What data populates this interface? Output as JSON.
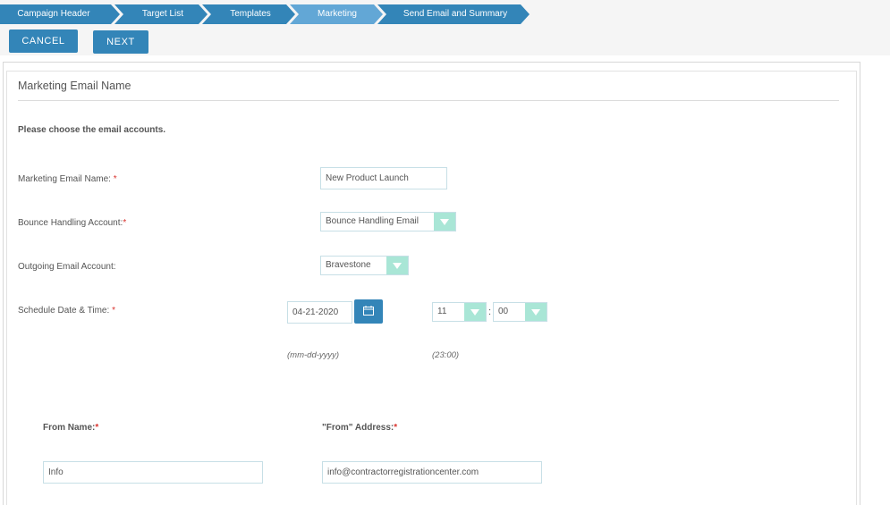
{
  "wizard": {
    "steps": [
      {
        "label": "Campaign Header",
        "active": false
      },
      {
        "label": "Target List",
        "active": false
      },
      {
        "label": "Templates",
        "active": false
      },
      {
        "label": "Marketing",
        "active": true
      },
      {
        "label": "Send Email and Summary",
        "active": false
      }
    ]
  },
  "actions": {
    "cancel_label": "CANCEL",
    "next_label": "NEXT"
  },
  "panel": {
    "title": "Marketing Email Name",
    "instruction": "Please choose the email accounts."
  },
  "form": {
    "marketing_email_name": {
      "label": "Marketing Email Name:",
      "required": "*",
      "value": "New Product Launch"
    },
    "bounce_account": {
      "label": "Bounce Handling Account:",
      "required": "*",
      "value": "Bounce Handling Email"
    },
    "outgoing_account": {
      "label": "Outgoing Email Account:",
      "value": "Bravestone"
    },
    "schedule": {
      "label": "Schedule Date & Time:",
      "required": "*",
      "date_value": "04-21-2020",
      "date_hint": "(mm-dd-yyyy)",
      "hour_value": "11",
      "separator": ":",
      "minute_value": "00",
      "time_hint": "(23:00)"
    },
    "from_name": {
      "label": "From Name:",
      "required": "*",
      "value": "Info"
    },
    "from_address": {
      "label": "\"From\" Address:",
      "required": "*",
      "value": "info@contractorregistrationcenter.com"
    }
  },
  "colors": {
    "accent": "#3385b8",
    "active_step": "#62a7d6",
    "select_arrow": "#a9e6d6",
    "required": "#d9332e"
  }
}
